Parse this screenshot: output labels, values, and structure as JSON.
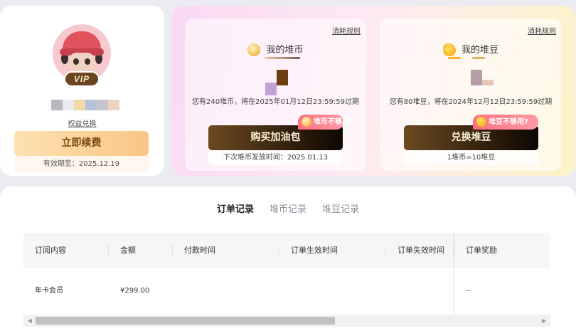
{
  "profile": {
    "vip_badge": "VIP",
    "rights_link": "权益兑换",
    "renew_button": "立即续费",
    "valid_until": "有效期至：2025.12.19"
  },
  "coins": {
    "dui": {
      "rule_link": "消耗规则",
      "title": "我的堆币",
      "expiry": "您有240堆币，将在2025年01月12日23:59:59过期",
      "tag": "堆币不够用?",
      "button": "购买加油包",
      "sub": "下次堆币发放时间：2025.01.13"
    },
    "dou": {
      "rule_link": "消耗规则",
      "title": "我的堆豆",
      "expiry": "您有80堆豆，将在2024年12月12日23:59:59过期",
      "tag": "堆豆不够用?",
      "button": "兑换堆豆",
      "sub": "1堆币=10堆豆"
    }
  },
  "records": {
    "tabs": [
      "订单记录",
      "堆币记录",
      "堆豆记录"
    ],
    "columns": [
      "订阅内容",
      "金额",
      "付款时间",
      "订单生效时间",
      "订单失效时间",
      "订单奖励"
    ],
    "rows": [
      [
        "年卡会员",
        "¥299.00",
        "",
        "",
        "",
        "--"
      ]
    ]
  },
  "colors": {
    "accent_highlight": "#d9ff2e",
    "renew_gold": "#f8c686",
    "dark_button": "#2a1a0a",
    "shortage_pink": "#ff6d7d"
  },
  "icons": {
    "coin": "coin-icon",
    "bean": "bean-icon",
    "scroll_left": "chevron-left-icon",
    "scroll_right": "chevron-right-icon"
  }
}
